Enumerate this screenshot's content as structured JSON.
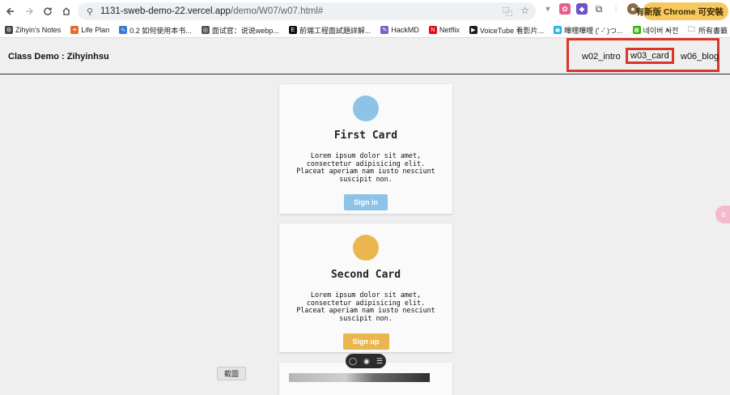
{
  "browser": {
    "url_host": "1131-sweb-demo-22.vercel.app",
    "url_path": "/demo/W07/w07.html#",
    "update_label": "有新版 Chrome 可安裝"
  },
  "bookmarks": [
    {
      "label": "Zihyin's Notes",
      "color": "#444444",
      "glyph": "⚙"
    },
    {
      "label": "Life Plan",
      "color": "#e86a2c",
      "glyph": "✦"
    },
    {
      "label": "0.2  如何使用本书...",
      "color": "#3a7bd5",
      "glyph": "∿"
    },
    {
      "label": "面试官：说说webp...",
      "color": "#555555",
      "glyph": "◎"
    },
    {
      "label": "前端工程面試題詳解...",
      "color": "#111111",
      "glyph": "E"
    },
    {
      "label": "HackMD",
      "color": "#7b61c7",
      "glyph": "✎"
    },
    {
      "label": "Netflix",
      "color": "#e50914",
      "glyph": "N"
    },
    {
      "label": "VoiceTube 看影片...",
      "color": "#1d1d1d",
      "glyph": "▶"
    },
    {
      "label": "嗶哩嗶哩 (' -' )つ...",
      "color": "#23ade5",
      "glyph": "▣"
    },
    {
      "label": "네이버 사전",
      "color": "#2db400",
      "glyph": "▦"
    }
  ],
  "bookmarks_overflow": "»",
  "bookmarks_all": "所有書籤",
  "header": {
    "brand": "Class Demo : Zihyinhsu",
    "nav": [
      "w02_intro",
      "w03_card",
      "w06_blog"
    ]
  },
  "cards": [
    {
      "title": "First Card",
      "body": "Lorem ipsum dolor sit amet, consectetur adipisicing elit. Placeat aperiam nam iusto nesciunt suscipit non.",
      "button": "Sign in",
      "color": "#8dc3e6"
    },
    {
      "title": "Second Card",
      "body": "Lorem ipsum dolor sit amet, consectetur adipisicing elit. Placeat aperiam nam iusto nesciunt suscipit non.",
      "button": "Sign up",
      "color": "#eab64f"
    }
  ],
  "capture_label": "截圖",
  "side_tab_label": "ö"
}
